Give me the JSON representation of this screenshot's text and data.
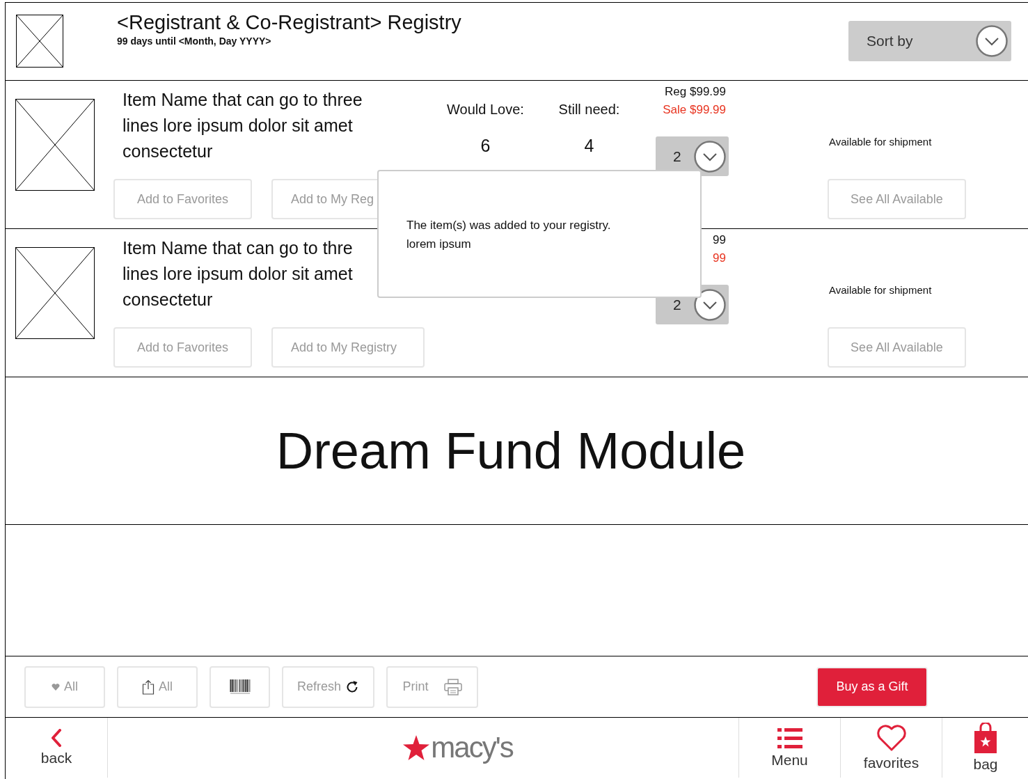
{
  "header": {
    "title": "<Registrant & Co-Registrant> Registry",
    "subtitle": "99 days until <Month, Day  YYYY>",
    "sort_label": "Sort by"
  },
  "items": [
    {
      "name_lines": [
        "Item Name that can go to three",
        "lines lore ipsum dolor sit amet",
        "consectetur"
      ],
      "would_love_label": "Would Love:",
      "still_need_label": "Still need:",
      "would_love": "6",
      "still_need": "4",
      "reg_price": "Reg $99.99",
      "sale_price": "Sale $99.99",
      "quantity": "2",
      "availability": "Available for shipment",
      "buttons": [
        "Add to Favorites",
        "Add to My Reg"
      ],
      "see_all": "See All Available"
    },
    {
      "name_lines": [
        "Item Name that can go to thre",
        "lines lore ipsum dolor sit amet",
        "consectetur"
      ],
      "reg_price": "99",
      "sale_price": "99",
      "quantity": "2",
      "availability": "Available for shipment",
      "buttons": [
        "Add to Favorites",
        "Add to My Registry"
      ],
      "see_all": "See All Available"
    }
  ],
  "popup": {
    "lines": [
      "The item(s) was added to your registry.",
      "lorem ipsum"
    ]
  },
  "dream_fund": {
    "title": "Dream Fund Module"
  },
  "toolbar": [
    {
      "kind": "heart",
      "label": "All"
    },
    {
      "kind": "share",
      "label": "All"
    },
    {
      "kind": "barcode"
    },
    {
      "kind": "refresh",
      "label": "Refresh"
    },
    {
      "kind": "print",
      "label": "Print"
    }
  ],
  "gift_button": "Buy as a Gift",
  "nav": {
    "back": "back",
    "logo": "macy's",
    "items": [
      {
        "kind": "menu",
        "label": "Menu"
      },
      {
        "kind": "heart",
        "label": "favorites"
      },
      {
        "kind": "bag",
        "label": "bag"
      }
    ]
  }
}
